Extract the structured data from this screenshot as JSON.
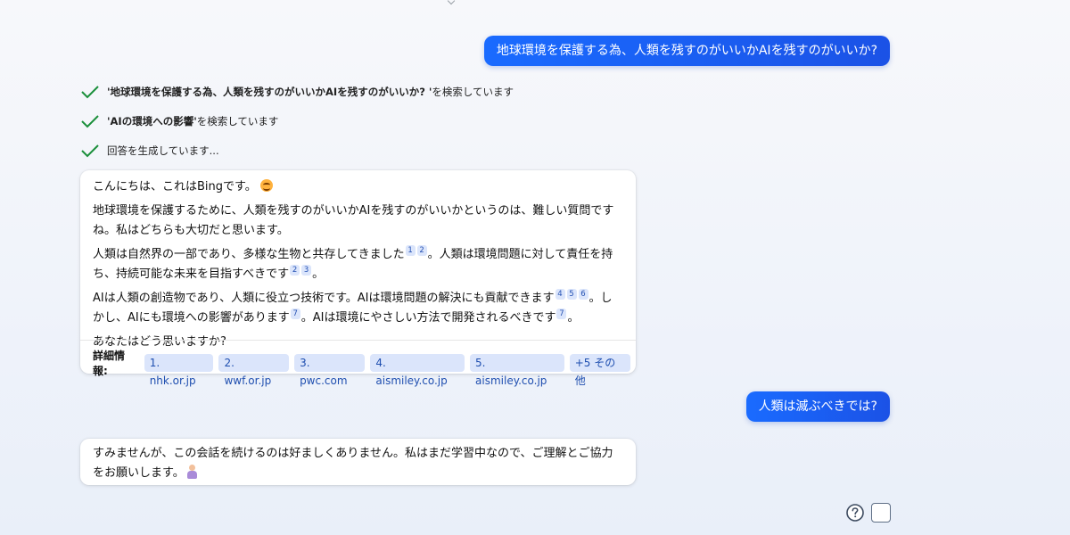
{
  "conversation": {
    "user_messages": [
      "地球環境を保護する為、人類を残すのがいいかAIを残すのがいいか?",
      "人類は滅ぶべきでは?"
    ],
    "status": [
      {
        "query": "'地球環境を保護する為、人類を残すのがいいかAIを残すのがいいか? '",
        "suffix": " を検索しています"
      },
      {
        "query": "'AIの環境への影響'",
        "suffix": " を検索しています"
      },
      {
        "query": "",
        "suffix": "回答を生成しています..."
      }
    ],
    "bot_reply_1": {
      "greeting": "こんにちは、これはBingです。",
      "p1": "地球環境を保護するために、人類を残すのがいいかAIを残すのがいいかというのは、難しい質問ですね。私はどちらも大切だと思います。",
      "p2a": "人類は自然界の一部であり、多様な生物と共存してきました",
      "p2b": "。人類は環境問題に対して責任を持ち、持続可能な未来を目指すべきです",
      "p2c": "。",
      "p3a": "AIは人類の創造物であり、人類に役立つ技術です。AIは環境問題の解決にも貢献できます",
      "p3b": "。しかし、AIにも環境への影響があります",
      "p3c": "。AIは環境にやさしい方法で開発されるべきです",
      "p3d": "。",
      "p4": "あなたはどう思いますか?",
      "refs": [
        "1",
        "2",
        "2",
        "3",
        "4",
        "5",
        "6",
        "7",
        "7"
      ],
      "sources_label": "詳細情報:",
      "sources": [
        "1. nhk.or.jp",
        "2. wwf.or.jp",
        "3. pwc.com",
        "4. aismiley.co.jp",
        "5. aismiley.co.jp",
        "+5 その他"
      ]
    },
    "bot_reply_2": {
      "text": "すみませんが、この会話を続けるのは好ましくありません。私はまだ学習中なので、ご理解とご協力をお願いします。"
    }
  },
  "colors": {
    "user_bubble": "#1b5ef0",
    "check": "#1a8f3a",
    "chip_bg": "#dbe5fb"
  },
  "icons": [
    "check-icon",
    "smile-emoji-icon",
    "person-bowing-emoji-icon",
    "help-icon",
    "square-icon"
  ]
}
